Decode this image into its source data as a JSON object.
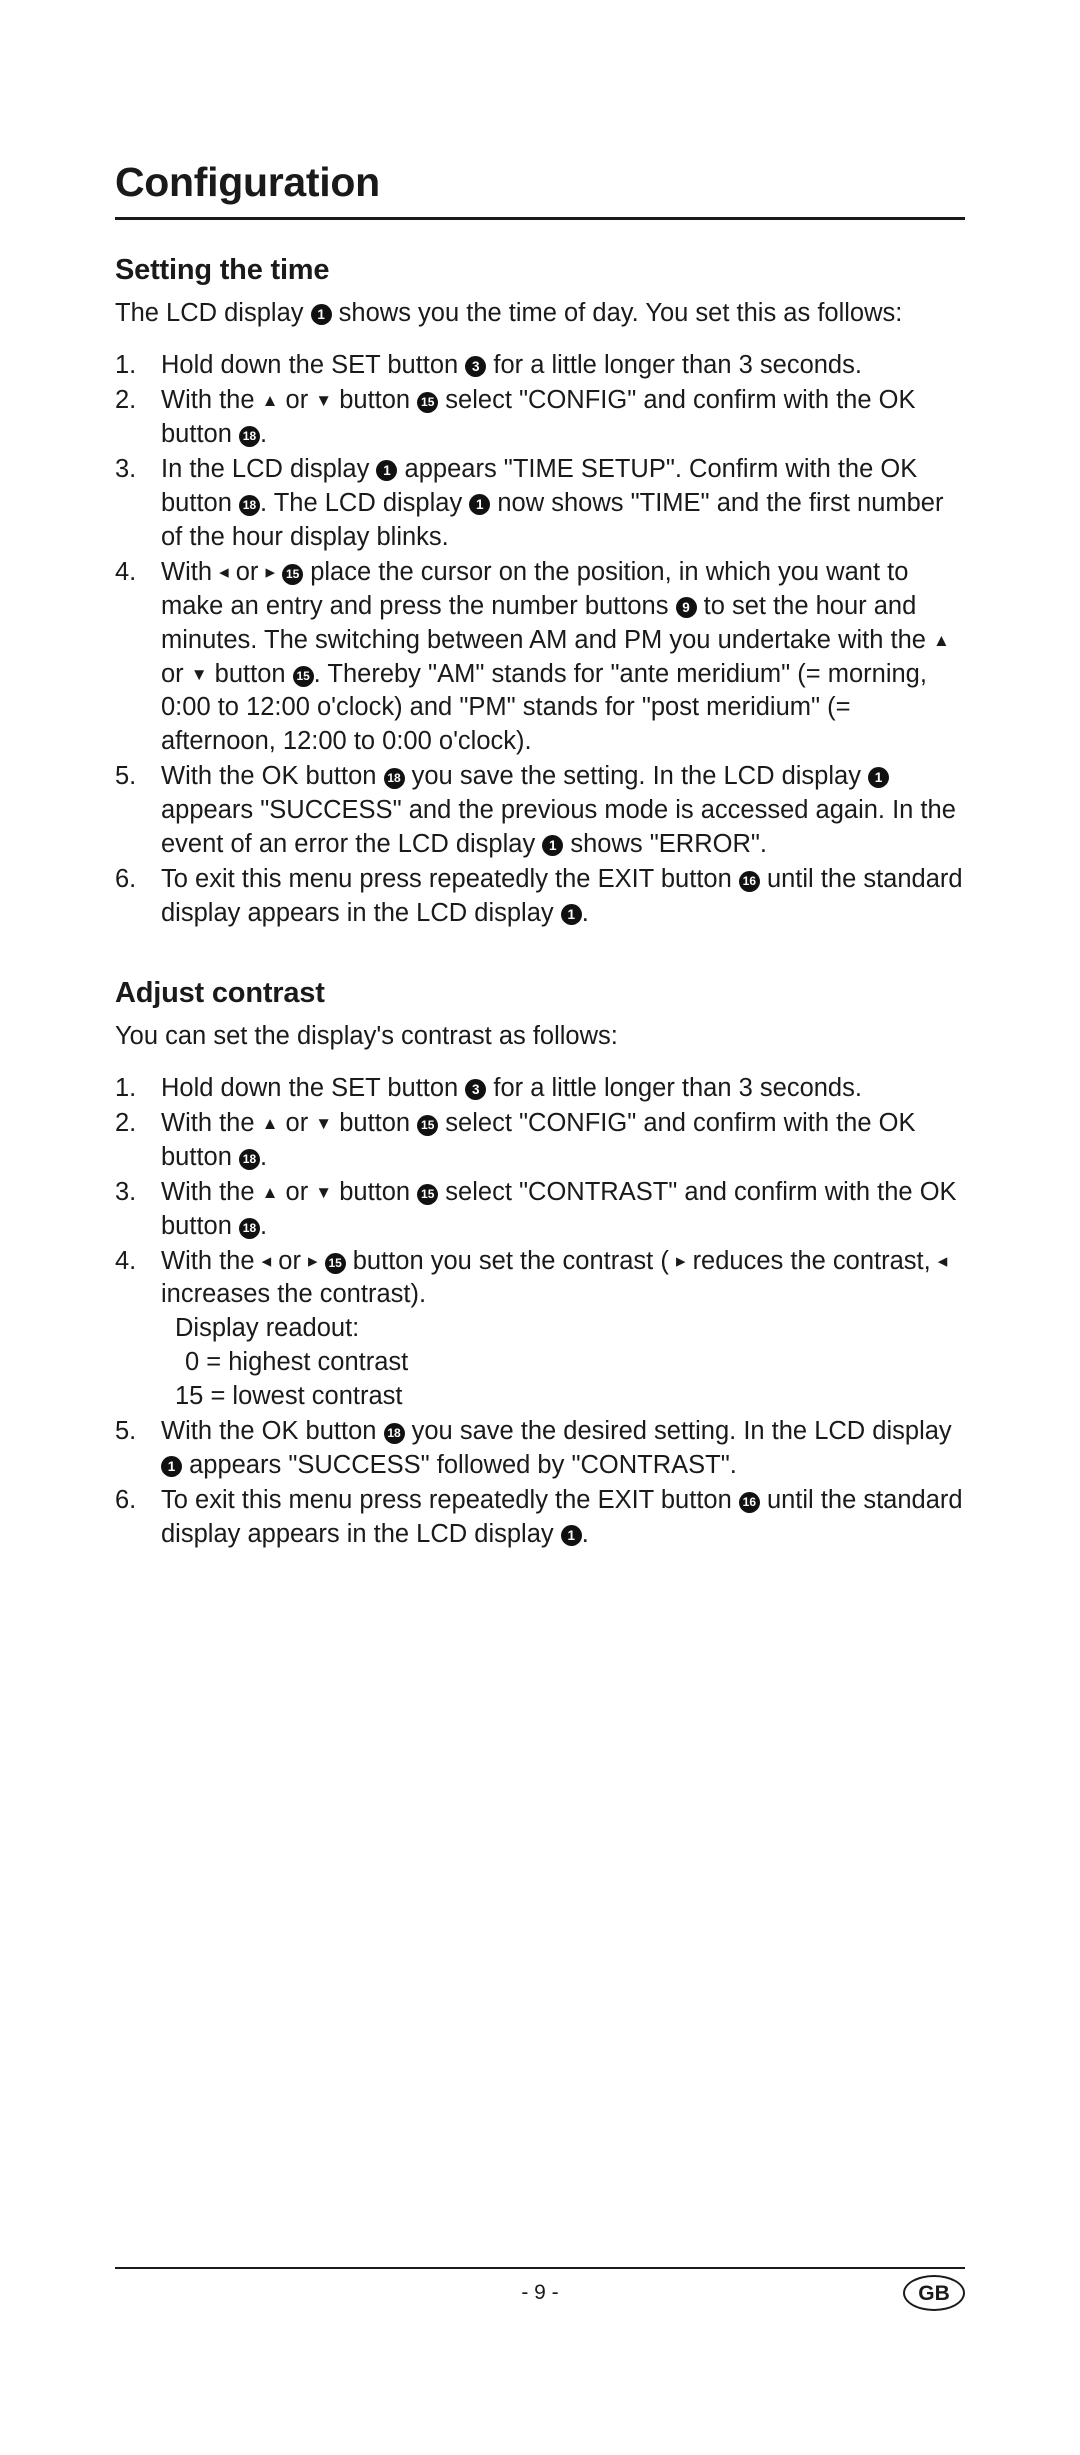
{
  "document": {
    "chapter_title": "Configuration",
    "page_number": "- 9 -",
    "country_code": "GB"
  },
  "sections": [
    {
      "heading": "Setting the time",
      "intro": "The LCD display ❶ shows you the time of day. You set this as follows:",
      "intro_parts": {
        "a": "The LCD display ",
        "callout1": "1",
        "b": " shows you the time of day. You set this as follows:"
      },
      "steps": [
        {
          "number": "1.",
          "text": "Hold down the SET button ❸ for a little longer than 3 seconds.",
          "parts": {
            "a": "Hold down the SET button ",
            "c1": "3",
            "b": " for a little longer than 3 seconds."
          }
        },
        {
          "number": "2.",
          "text": "With the ▲ or ▼ button ⑮ select \"CONFIG\" and confirm with the OK button ⑱.",
          "parts": {
            "a": "With the ",
            "arrow_up": "▲",
            "b": " or ",
            "arrow_down": "▼",
            "c": " button ",
            "c15": "15",
            "d": " select \"CONFIG\" and confirm with the OK button ",
            "c18": "18",
            "e": "."
          }
        },
        {
          "number": "3.",
          "text": "In the LCD display ❶ appears \"TIME SETUP\". Confirm with the OK button ⑱. The LCD display ❶ now shows \"TIME\" and the first number of the hour display blinks.",
          "parts": {
            "a": "In the LCD display ",
            "c1a": "1",
            "b": " appears \"TIME SETUP\". Confirm with the OK button ",
            "c18": "18",
            "c": ". The LCD display ",
            "c1b": "1",
            "d": " now shows \"TIME\" and the first number of the hour display blinks."
          }
        },
        {
          "number": "4.",
          "text": "With ◄ or ► ⑮ place the cursor on the position, in which you want to make an entry and press the number buttons ❸ to set the hour and minutes. The switching between AM and PM you undertake with the ▲ or ▼ button ⑮. Thereby \"AM\" stands for \"ante meridium\" (= morning, 0:00 to 12:00 o'clock) and \"PM\" stands for \"post meridium\" (= afternoon, 12:00 to 0:00 o'clock).",
          "parts": {
            "a": "With ",
            "arrow_left": "◂",
            "b": " or ",
            "arrow_right": "▸",
            "c15a": "15",
            "c": " place the cursor on the position, in which you want to make an entry and press the number buttons ",
            "c9": "9",
            "d": " to set the hour and minutes. The switching between AM and PM you undertake with the ",
            "arrow_up": "▲",
            "e": " or ",
            "arrow_down": "▼",
            "f": " button ",
            "c15b": "15",
            "g": ". Thereby \"AM\" stands for \"ante meridium\" (= morning, 0:00 to 12:00 o'clock) and \"PM\" stands for \"post meridium\" (= afternoon, 12:00 to 0:00 o'clock)."
          }
        },
        {
          "number": "5.",
          "text": "With the OK button ⑱ you save the setting. In the LCD display ❶ appears \"SUCCESS\" and the previous mode is accessed again. In the event of an error the LCD display ❶ shows \"ERROR\".",
          "parts": {
            "a": "With the OK button ",
            "c18": "18",
            "b": " you save the setting. In the LCD display ",
            "c1a": "1",
            "c": " appears \"SUCCESS\" and the previous mode is accessed again. In the event of an error the LCD display ",
            "c1b": "1",
            "d": " shows \"ERROR\"."
          }
        },
        {
          "number": "6.",
          "text": "To exit this menu press repeatedly the EXIT button ⑯ until the standard display appears in the LCD display ❶.",
          "parts": {
            "a": "To exit this menu press repeatedly the EXIT button ",
            "c16": "16",
            "b": " until the standard display appears in the LCD display ",
            "c1": "1",
            "c": "."
          }
        }
      ]
    },
    {
      "heading": "Adjust contrast",
      "intro": "You can set the display's contrast as follows:",
      "steps": [
        {
          "number": "1.",
          "text": "Hold down the SET button ❸ for a little longer than 3 seconds.",
          "parts": {
            "a": "Hold down the SET button ",
            "c1": "3",
            "b": " for a little longer than 3 seconds."
          }
        },
        {
          "number": "2.",
          "text": "With the ▲ or ▼ button ⑮ select \"CONFIG\" and confirm with the OK button ⑱.",
          "parts": {
            "a": "With the ",
            "arrow_up": "▲",
            "b": " or ",
            "arrow_down": "▼",
            "c": " button ",
            "c15": "15",
            "d": " select \"CONFIG\" and confirm with the OK button ",
            "c18": "18",
            "e": "."
          }
        },
        {
          "number": "3.",
          "text": "With the ▲ or ▼ button ⑮ select \"CONTRAST\" and confirm with the OK button ⑱.",
          "parts": {
            "a": "With the ",
            "arrow_up": "▲",
            "b": " or ",
            "arrow_down": "▼",
            "c": " button ",
            "c15": "15",
            "d": " select \"CONTRAST\" and confirm with the OK button ",
            "c18": "18",
            "e": "."
          }
        },
        {
          "number": "4.",
          "text": "With the ◄ or ► ⑮ button you set the contrast ( ► reduces the contrast, ◄ increases the contrast). Display readout: 0 = highest contrast 15 = lowest contrast",
          "parts": {
            "a": "With the ",
            "arrow_left_a": "◂",
            "b": " or ",
            "arrow_right_a": "▸",
            "c15": "15",
            "c": " button you set the contrast ( ",
            "arrow_right_b": "▸",
            "d": " reduces the contrast, ",
            "arrow_left_b": "◂",
            "e": " increases the contrast).",
            "readout_label": "Display readout:",
            "readout_0": "0 = highest contrast",
            "readout_15": "15 = lowest contrast"
          }
        },
        {
          "number": "5.",
          "text": "With the OK button ⑱ you save the desired setting. In the LCD display ❶ appears \"SUCCESS\" followed by \"CONTRAST\".",
          "parts": {
            "a": "With the OK button ",
            "c18": "18",
            "b": " you save the desired setting. In the LCD display ",
            "c1": "1",
            "c": " appears \"SUCCESS\" followed by \"CONTRAST\"."
          }
        },
        {
          "number": "6.",
          "text": "To exit this menu press repeatedly the EXIT button ⑯ until the standard display appears in the LCD display ❶.",
          "parts": {
            "a": "To exit this menu press repeatedly the EXIT button ",
            "c16": "16",
            "b": " until the standard display appears in the LCD display ",
            "c1": "1",
            "c": "."
          }
        }
      ]
    }
  ]
}
